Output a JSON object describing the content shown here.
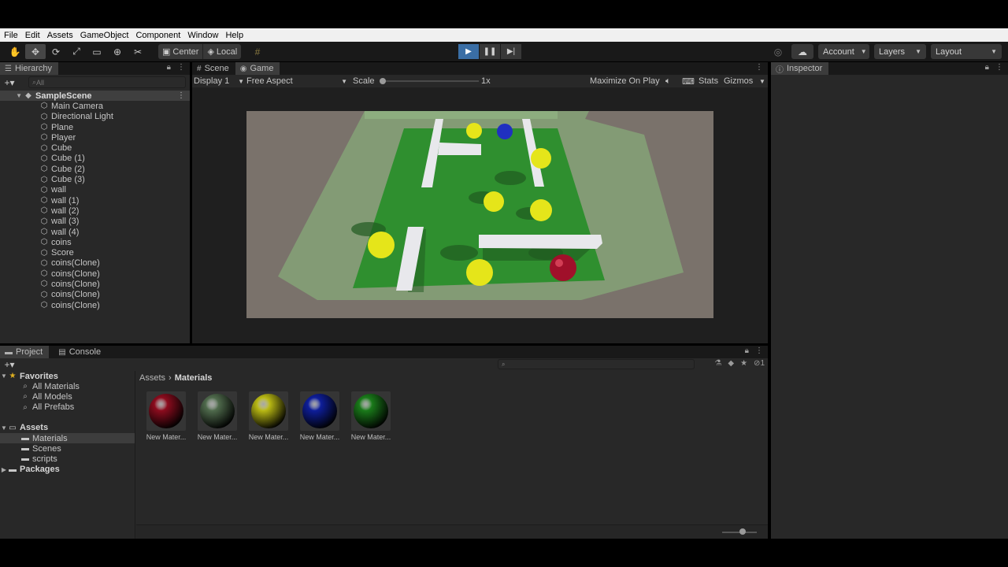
{
  "menu": [
    "File",
    "Edit",
    "Assets",
    "GameObject",
    "Component",
    "Window",
    "Help"
  ],
  "toolbar": {
    "pivot": "Center",
    "space": "Local",
    "account": "Account",
    "layers": "Layers",
    "layout": "Layout"
  },
  "hierarchy": {
    "tab": "Hierarchy",
    "search_placeholder": "All",
    "scene": "SampleScene",
    "items": [
      "Main Camera",
      "Directional Light",
      "Plane",
      "Player",
      "Cube",
      "Cube (1)",
      "Cube (2)",
      "Cube (3)",
      "wall",
      "wall (1)",
      "wall (2)",
      "wall (3)",
      "wall (4)",
      "coins",
      "Score",
      "coins(Clone)",
      "coins(Clone)",
      "coins(Clone)",
      "coins(Clone)",
      "coins(Clone)"
    ]
  },
  "gameview": {
    "tabs": [
      "Scene",
      "Game"
    ],
    "display": "Display 1",
    "aspect": "Free Aspect",
    "scale_label": "Scale",
    "scale_value": "1x",
    "maximize": "Maximize On Play",
    "stats": "Stats",
    "gizmos": "Gizmos"
  },
  "inspector": {
    "tab": "Inspector"
  },
  "project": {
    "tabs": [
      "Project",
      "Console"
    ],
    "favorites_label": "Favorites",
    "favorites": [
      "All Materials",
      "All Models",
      "All Prefabs"
    ],
    "assets_label": "Assets",
    "asset_folders": [
      "Materials",
      "Scenes",
      "scripts"
    ],
    "packages_label": "Packages",
    "breadcrumb": [
      "Assets",
      "Materials"
    ],
    "hidden_count": "1",
    "materials": [
      {
        "label": "New Mater...",
        "color": "#8c0c1e"
      },
      {
        "label": "New Mater...",
        "color": "#4f6a4c"
      },
      {
        "label": "New Mater...",
        "color": "#b8b814"
      },
      {
        "label": "New Mater...",
        "color": "#0e1e9a"
      },
      {
        "label": "New Mater...",
        "color": "#1a7a1a"
      }
    ]
  },
  "colors": {
    "play_accent": "#3a6ea5",
    "ground_green": "#2f8f2f",
    "wall_white": "#e8e8ec",
    "coin_yellow": "#e5e51a",
    "player_red": "#a0102a",
    "enemy_blue": "#2030c0"
  }
}
